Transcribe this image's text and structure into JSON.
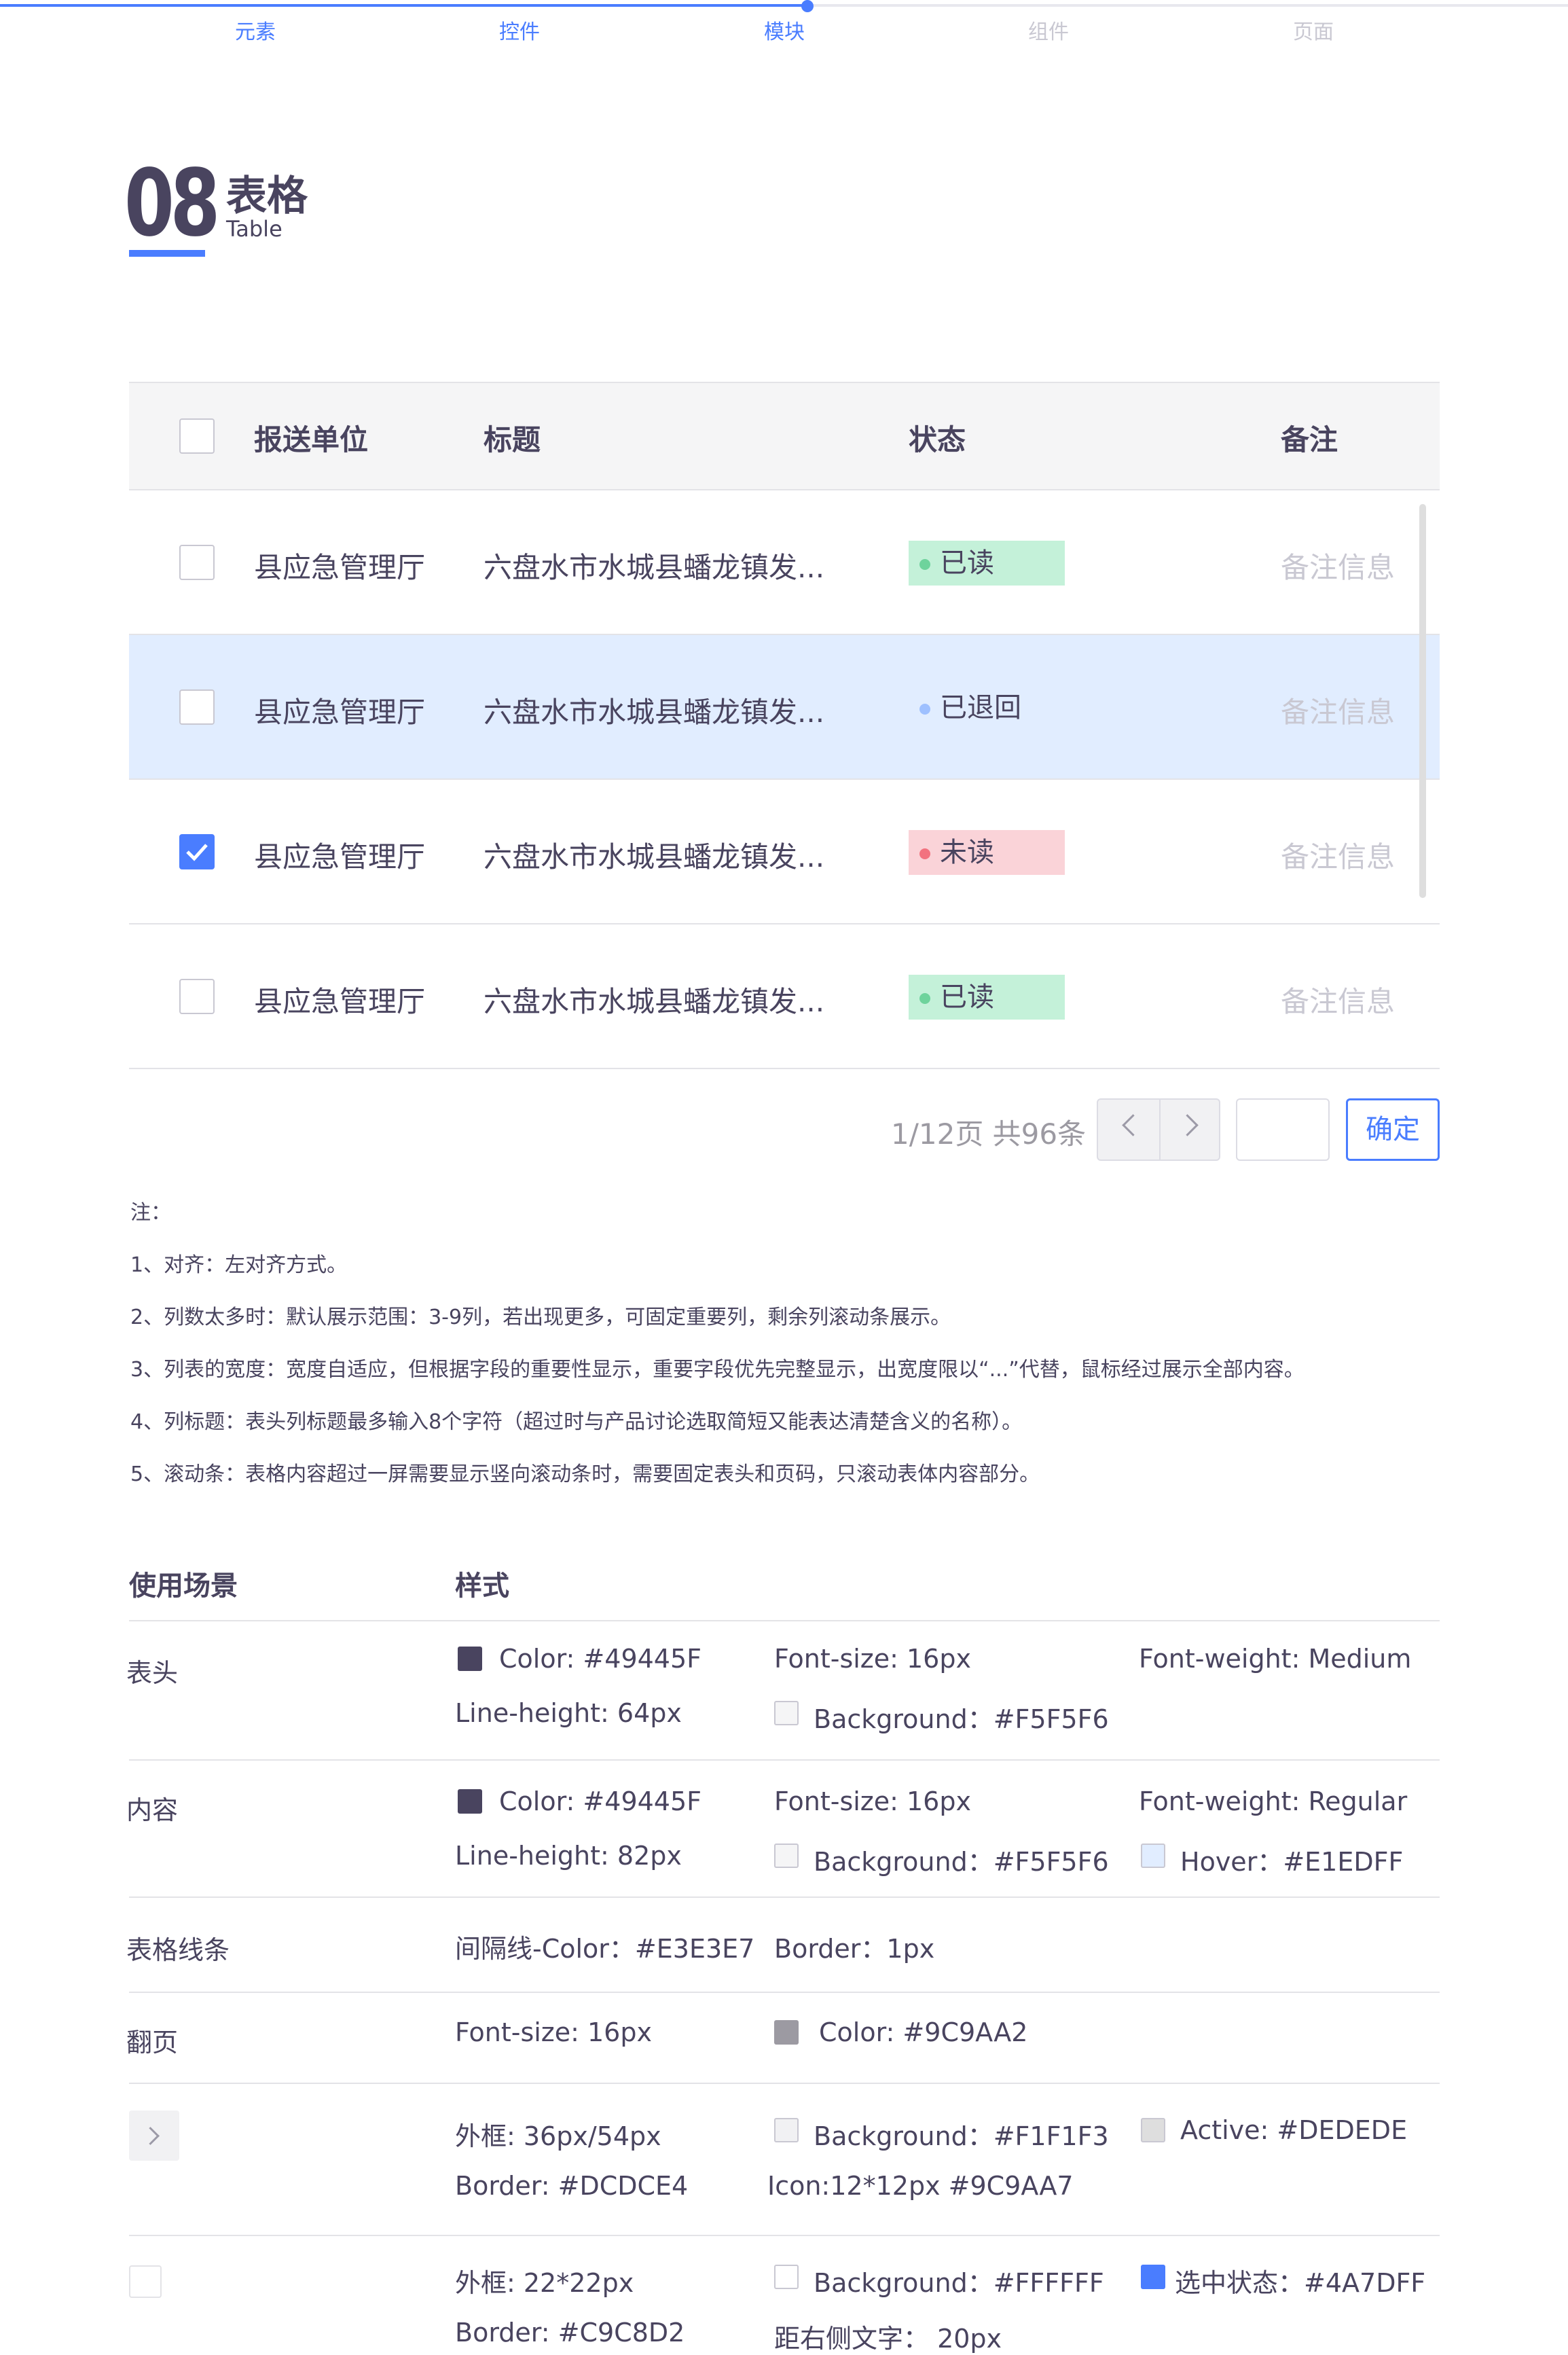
{
  "nav": {
    "items": [
      {
        "label": "元素",
        "active": true
      },
      {
        "label": "控件",
        "active": true
      },
      {
        "label": "模块",
        "active": true
      },
      {
        "label": "组件",
        "active": false
      },
      {
        "label": "页面",
        "active": false
      }
    ]
  },
  "section": {
    "number": "08",
    "title": "表格",
    "subtitle": "Table"
  },
  "table": {
    "headers": [
      "报送单位",
      "标题",
      "状态",
      "备注"
    ],
    "rows": [
      {
        "unit": "县应急管理厅",
        "title": "六盘水市水城县蟠龙镇发...",
        "status": "已读",
        "status_type": "read",
        "note": "备注信息",
        "checked": false,
        "hover": false
      },
      {
        "unit": "县应急管理厅",
        "title": "六盘水市水城县蟠龙镇发...",
        "status": "已退回",
        "status_type": "back",
        "note": "备注信息",
        "checked": false,
        "hover": true
      },
      {
        "unit": "县应急管理厅",
        "title": "六盘水市水城县蟠龙镇发...",
        "status": "未读",
        "status_type": "unread",
        "note": "备注信息",
        "checked": true,
        "hover": false
      },
      {
        "unit": "县应急管理厅",
        "title": "六盘水市水城县蟠龙镇发...",
        "status": "已读",
        "status_type": "read",
        "note": "备注信息",
        "checked": false,
        "hover": false
      }
    ]
  },
  "pagination": {
    "info": "1/12页 共96条",
    "prev_icon": "chevron-left-icon",
    "next_icon": "chevron-right-icon",
    "confirm_label": "确定",
    "page_input_value": ""
  },
  "notes": {
    "heading": "注：",
    "items": [
      "1、对齐：左对齐方式。",
      "2、列数太多时：默认展示范围：3-9列，若出现更多，可固定重要列，剩余列滚动条展示。",
      "3、列表的宽度：宽度自适应，但根据字段的重要性显示，重要字段优先完整显示，出宽度限以“...”代替，鼠标经过展示全部内容。",
      "4、列标题：表头列标题最多输入8个字符（超过时与产品讨论选取简短又能表达清楚含义的名称）。",
      "5、滚动条：表格内容超过一屏需要显示竖向滚动条时，需要固定表头和页码，只滚动表体内容部分。"
    ]
  },
  "spec": {
    "col_scene": "使用场景",
    "col_style": "样式",
    "header_row": {
      "label": "表头",
      "color": "Color: #49445F",
      "font_size": "Font-size: 16px",
      "font_weight": "Font-weight: Medium",
      "line_height": "Line-height: 64px",
      "background": "Background：#F5F5F6"
    },
    "content_row": {
      "label": "内容",
      "color": "Color: #49445F",
      "font_size": "Font-size: 16px",
      "font_weight": "Font-weight: Regular",
      "line_height": "Line-height: 82px",
      "background": "Background：#F5F5F6",
      "hover": "Hover：#E1EDFF"
    },
    "line_row": {
      "label": "表格线条",
      "color": "间隔线-Color：#E3E3E7",
      "border": "Border：1px"
    },
    "page_row": {
      "label": "翻页",
      "font_size": "Font-size: 16px",
      "color": "Color: #9C9AA2"
    },
    "btn_row": {
      "frame": "外框: 36px/54px",
      "background": "Background：#F1F1F3",
      "active": "Active:  #DEDEDE",
      "border": "Border: #DCDCE4",
      "icon": "Icon:12*12px   #9C9AA7"
    },
    "cb_row": {
      "frame": "外框: 22*22px",
      "background": "Background：#FFFFFF",
      "checked": "选中状态：#4A7DFF",
      "border": "Border: #C9C8D2",
      "distance": "距右侧文字：  20px"
    }
  },
  "colors": {
    "accent": "#4A7DFF",
    "text": "#49445F",
    "muted": "#9C9AA2",
    "placeholder": "#C9C8D2",
    "line": "#E3E3E7",
    "hover": "#E1EDFF"
  }
}
